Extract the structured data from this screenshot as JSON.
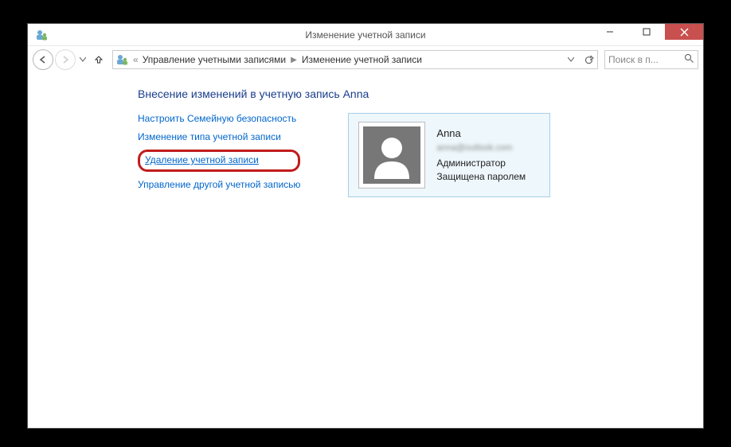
{
  "titlebar": {
    "title": "Изменение учетной записи"
  },
  "address": {
    "prefix": "«",
    "crumb1": "Управление учетными записями",
    "crumb2": "Изменение учетной записи"
  },
  "search": {
    "placeholder": "Поиск в п..."
  },
  "content": {
    "heading": "Внесение изменений в учетную запись Anna",
    "links": {
      "family_safety": "Настроить Семейную безопасность",
      "change_type": "Изменение типа учетной записи",
      "delete_account": "Удаление учетной записи",
      "manage_other": "Управление другой учетной записью"
    },
    "user": {
      "name": "Anna",
      "email": "anna@outlook.com",
      "role": "Администратор",
      "protection": "Защищена паролем"
    }
  }
}
